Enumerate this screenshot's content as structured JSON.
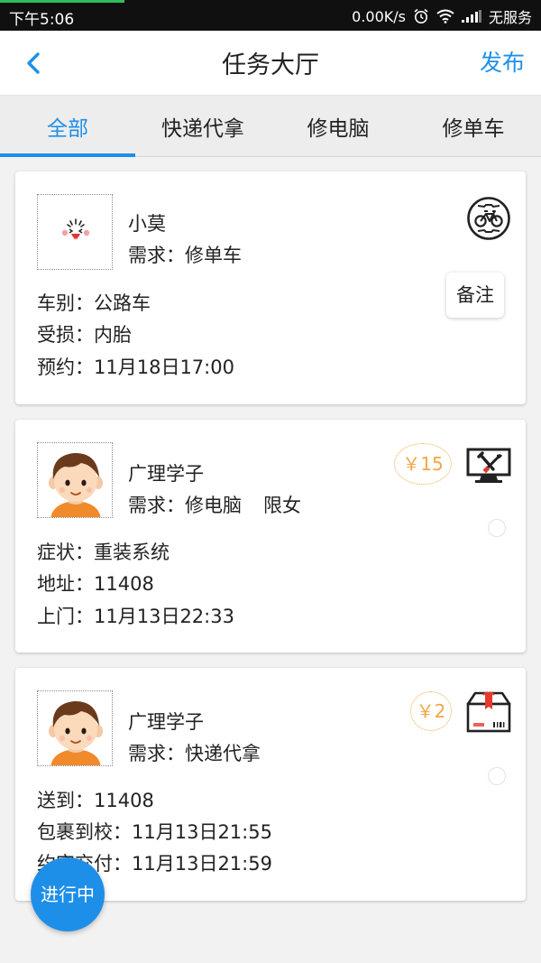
{
  "status_bar": {
    "time": "下午5:06",
    "network_speed": "0.00K/s",
    "carrier": "无服务",
    "icons": [
      "alarm-icon",
      "wifi-icon",
      "signal-icon"
    ]
  },
  "header": {
    "back_icon": "chevron-left-icon",
    "title": "任务大厅",
    "publish_label": "发布"
  },
  "tabs": [
    {
      "label": "全部",
      "active": true
    },
    {
      "label": "快递代拿",
      "active": false
    },
    {
      "label": "修电脑",
      "active": false
    },
    {
      "label": "修单车",
      "active": false
    }
  ],
  "tasks": [
    {
      "user": "小莫",
      "avatar": "cartoon-face-avatar",
      "demand": "需求：修单车",
      "type_icon": "bicycle-icon",
      "note_label": "备注",
      "details": [
        "车别：公路车",
        "受损：内胎",
        "预约：11月18日17:00"
      ]
    },
    {
      "user": "广理学子",
      "avatar": "boy-avatar",
      "demand": "需求：修电脑",
      "restriction": "限女",
      "price": "￥15",
      "type_icon": "computer-repair-icon",
      "details": [
        "症状：重装系统",
        "地址：11408",
        "上门：11月13日22:33"
      ]
    },
    {
      "user": "广理学子",
      "avatar": "boy-avatar",
      "demand": "需求：快递代拿",
      "price": "￥2",
      "type_icon": "package-icon",
      "details": [
        "送到：11408",
        "包裹到校：11月13日21:55",
        "约定交付：11月13日21:59"
      ]
    }
  ],
  "fab_label": "进行中",
  "colors": {
    "accent": "#1e8fe8",
    "price": "#f0a847",
    "background": "#f2f2f2"
  }
}
